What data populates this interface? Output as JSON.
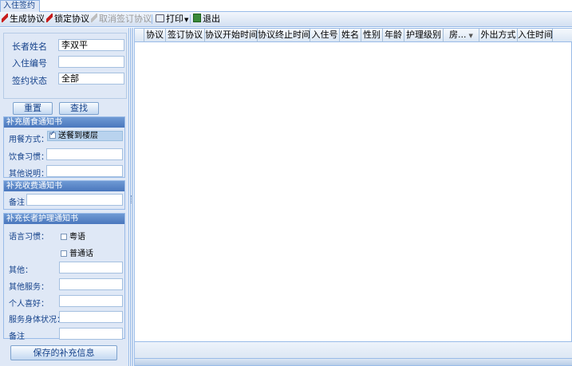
{
  "tab": {
    "label": "入住签约"
  },
  "toolbar": {
    "generate": "生成协议",
    "lock": "锁定协议",
    "cancel_sign": "取消签订协议",
    "print": "打印",
    "exit": "退出"
  },
  "search": {
    "elder_name_label": "长者姓名",
    "elder_name_value": "李双平",
    "checkin_no_label": "入住编号",
    "checkin_no_value": "",
    "sign_status_label": "签约状态",
    "sign_status_value": "全部",
    "reset": "重置",
    "find": "查找"
  },
  "diet": {
    "title": "补充膳食通知书",
    "meal_label": "用餐方式：",
    "meal_option": "送餐到楼层",
    "meal_checked": true,
    "habit_label": "饮食习惯：",
    "other_label": "其他说明："
  },
  "fee": {
    "title": "补充收费通知书",
    "note_label": "备注"
  },
  "care": {
    "title": "补充长者护理通知书",
    "language_label": "语言习惯：",
    "lang_option1": "粤语",
    "lang_option2": "普通话",
    "other_label": "其他：",
    "other_service_label": "其他服务：",
    "hobby_label": "个人喜好：",
    "body_label": "服务身体状况：",
    "note_label": "备注"
  },
  "save_button": "保存的补充信息",
  "grid": {
    "columns": [
      "协议",
      "签订协议",
      "协议开始时间",
      "协议终止时间",
      "入住号",
      "姓名",
      "性别",
      "年龄",
      "护理级别",
      "房...",
      "外出方式",
      "入住时间"
    ]
  },
  "colors": {
    "accent": "#15428b",
    "panel": "#dfe8f6",
    "section_head": "#4a77bd"
  }
}
